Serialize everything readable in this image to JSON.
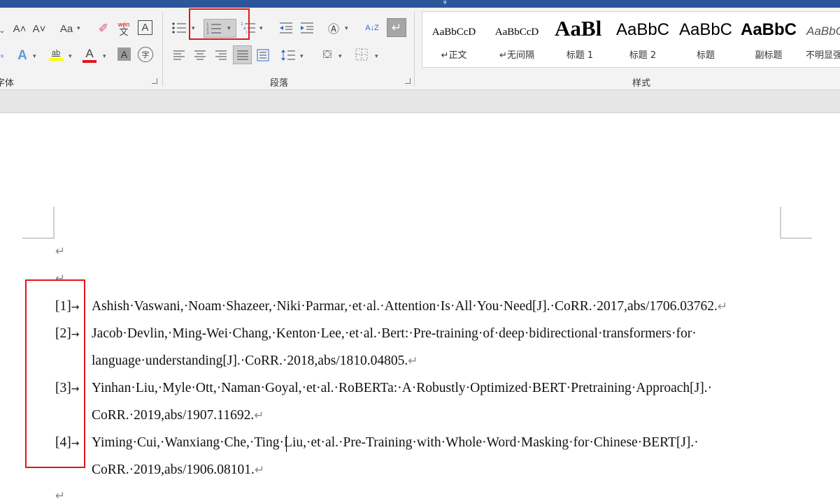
{
  "ribbon": {
    "font_group_label": "字体",
    "paragraph_group_label": "段落",
    "styles_group_label": "样式",
    "font_buttons": {
      "grow": "A˄",
      "shrink": "A˅",
      "change_case": "Aa",
      "clear_format": "✐",
      "phonetic_top": "wén",
      "phonetic_bottom": "文",
      "char_border": "A",
      "text_effects": "A",
      "highlight": "ab",
      "font_color": "A",
      "char_shading": "A",
      "enclose": "字"
    },
    "paragraph_buttons": {
      "sort": "A↓Z",
      "show_marks": "↵"
    },
    "styles": [
      {
        "sample": "AaBbCcD",
        "name": "↵正文"
      },
      {
        "sample": "AaBbCcD",
        "name": "↵无间隔"
      },
      {
        "sample": "AaBl",
        "name": "标题 1"
      },
      {
        "sample": "AaBbC",
        "name": "标题 2"
      },
      {
        "sample": "AaBbC",
        "name": "标题"
      },
      {
        "sample": "AaBbC",
        "name": "副标题"
      },
      {
        "sample": "AaBbC",
        "name": "不明显强"
      }
    ],
    "colors": {
      "highlight": "#ffff00",
      "font_color": "#e0161c",
      "annotation": "#e0161c",
      "title_bar": "#2b579a"
    }
  },
  "document": {
    "references": [
      {
        "num": "[1]",
        "lines": [
          "Ashish·Vaswani,·Noam·Shazeer,·Niki·Parmar,·et·al.·Attention·Is·All·You·Need[J].·CoRR.·2017,abs/1706.03762."
        ]
      },
      {
        "num": "[2]",
        "lines": [
          "Jacob·Devlin,·Ming-Wei·Chang,·Kenton·Lee,·et·al.·Bert:·Pre-training·of·deep·bidirectional·transformers·for·",
          "language·understanding[J].·CoRR.·2018,abs/1810.04805."
        ]
      },
      {
        "num": "[3]",
        "lines": [
          "Yinhan·Liu,·Myle·Ott,·Naman·Goyal,·et·al.·RoBERTa:·A·Robustly·Optimized·BERT·Pretraining·Approach[J].·",
          "CoRR.·2019,abs/1907.11692."
        ]
      },
      {
        "num": "[4]",
        "lines": [
          "Yiming·Cui,·Wanxiang·Che,·Ting·Liu,·et·al.·Pre-Training·with·Whole·Word·Masking·for·Chinese·BERT[J].·",
          "CoRR.·2019,abs/1906.08101."
        ]
      }
    ],
    "paragraph_mark": "↵",
    "tab_arrow": "→"
  }
}
